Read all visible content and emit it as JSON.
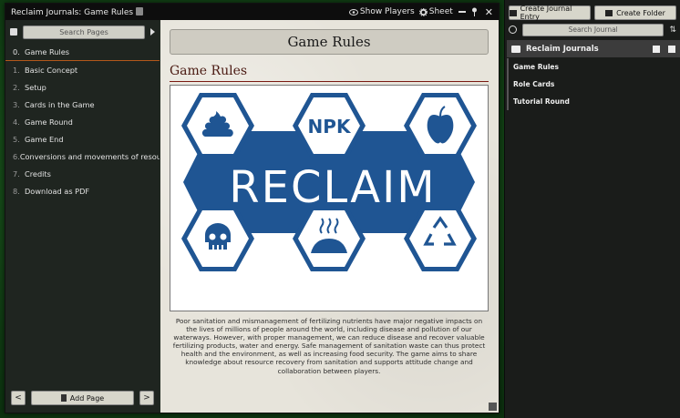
{
  "window": {
    "title": "Reclaim Journals: Game Rules",
    "show_players_label": "Show Players",
    "sheet_label": "Sheet",
    "close_glyph": "✕"
  },
  "pages": {
    "search_placeholder": "Search Pages",
    "items": [
      {
        "num": "0.",
        "label": "Game Rules"
      },
      {
        "num": "1.",
        "label": "Basic Concept"
      },
      {
        "num": "2.",
        "label": "Setup"
      },
      {
        "num": "3.",
        "label": "Cards in the Game"
      },
      {
        "num": "4.",
        "label": "Game Round"
      },
      {
        "num": "5.",
        "label": "Game End"
      },
      {
        "num": "6.",
        "label": "Conversions and movements of resourc..."
      },
      {
        "num": "7.",
        "label": "Credits"
      },
      {
        "num": "8.",
        "label": "Download as PDF"
      }
    ],
    "prev_glyph": "<",
    "next_glyph": ">",
    "add_page_label": "Add Page"
  },
  "content": {
    "page_title": "Game Rules",
    "heading": "Game Rules",
    "image": {
      "logo_text": "RECLAIM",
      "npk_text": "NPK",
      "icons": [
        "poop-icon",
        "npk-hex",
        "apple-icon",
        "skull-icon",
        "compost-heap-icon",
        "recycle-icon"
      ],
      "colors": {
        "brand_blue": "#1f5593",
        "white": "#ffffff"
      }
    },
    "paragraph": "Poor sanitation and mismanagement of fertilizing nutrients have major negative impacts on the lives of millions of people around the world, including disease and pollution of our waterways. However, with proper management, we can reduce disease and recover valuable fertilizing products, water and energy. Safe management of sanitation waste can thus protect health and the environment, as well as increasing food security. The game aims to share knowledge about resource recovery from sanitation and supports attitude change and collaboration between players."
  },
  "sidebar": {
    "create_entry_label": "Create Journal Entry",
    "create_folder_label": "Create Folder",
    "search_placeholder": "Search Journal",
    "folder_name": "Reclaim Journals",
    "entries": [
      "Game Rules",
      "Role Cards",
      "Tutorial Round"
    ]
  }
}
